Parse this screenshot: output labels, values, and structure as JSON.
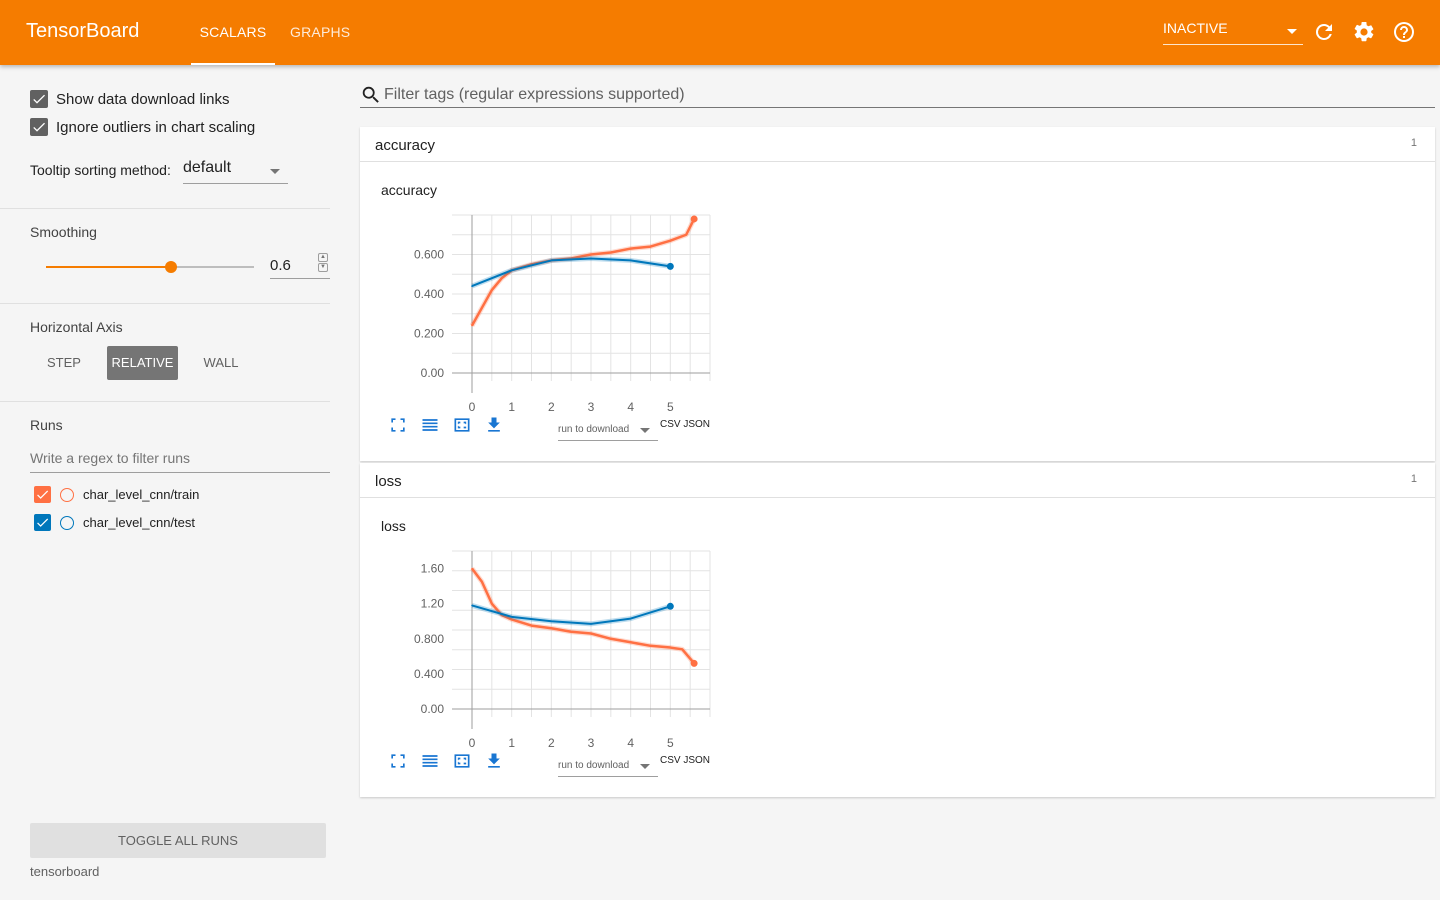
{
  "app": {
    "title": "TensorBoard",
    "tabs": [
      {
        "label": "SCALARS",
        "active": true
      },
      {
        "label": "GRAPHS",
        "active": false
      }
    ],
    "status_select": "INACTIVE",
    "icons": [
      "refresh-icon",
      "settings-icon",
      "help-icon"
    ],
    "accent_color": "#f57c00"
  },
  "sidebar": {
    "show_download_links": {
      "label": "Show data download links",
      "checked": true
    },
    "ignore_outliers": {
      "label": "Ignore outliers in chart scaling",
      "checked": true
    },
    "tooltip_sorting": {
      "label": "Tooltip sorting method:",
      "value": "default"
    },
    "smoothing": {
      "title": "Smoothing",
      "value": "0.6",
      "fraction": 0.6
    },
    "horizontal_axis": {
      "title": "Horizontal Axis",
      "options": [
        "STEP",
        "RELATIVE",
        "WALL"
      ],
      "selected": "RELATIVE"
    },
    "runs": {
      "title": "Runs",
      "filter_placeholder": "Write a regex to filter runs",
      "items": [
        {
          "name": "char_level_cnn/train",
          "color": "#ff7043",
          "checked": true
        },
        {
          "name": "char_level_cnn/test",
          "color": "#0077bb",
          "checked": true
        }
      ]
    },
    "toggle_all_label": "TOGGLE ALL RUNS",
    "footer": "tensorboard"
  },
  "main": {
    "search_placeholder": "Filter tags (regular expressions supported)",
    "panes": [
      {
        "title": "accuracy",
        "count": "1",
        "card_title": "accuracy"
      },
      {
        "title": "loss",
        "count": "1",
        "card_title": "loss"
      }
    ],
    "download": {
      "select_label": "run to download",
      "csv": "CSV",
      "json": "JSON"
    }
  },
  "chart_data": [
    {
      "type": "line",
      "title": "accuracy",
      "xlim": [
        0,
        6
      ],
      "ylim": [
        0,
        0.8
      ],
      "x_ticks": [
        "0",
        "1",
        "2",
        "3",
        "4",
        "5"
      ],
      "y_ticks": [
        "0.00",
        "0.200",
        "0.400",
        "0.600"
      ],
      "series": [
        {
          "name": "char_level_cnn/train",
          "color": "#ff7043",
          "x": [
            0,
            0.25,
            0.5,
            0.75,
            1,
            1.5,
            2,
            2.5,
            3,
            3.5,
            4,
            4.5,
            5,
            5.4,
            5.6
          ],
          "y": [
            0.24,
            0.33,
            0.42,
            0.48,
            0.52,
            0.55,
            0.57,
            0.58,
            0.6,
            0.61,
            0.63,
            0.64,
            0.67,
            0.7,
            0.78
          ]
        },
        {
          "name": "char_level_cnn/test",
          "color": "#0077bb",
          "x": [
            0,
            1,
            2,
            3,
            4,
            5
          ],
          "y": [
            0.44,
            0.52,
            0.57,
            0.58,
            0.57,
            0.54
          ]
        }
      ]
    },
    {
      "type": "line",
      "title": "loss",
      "xlim": [
        0,
        6
      ],
      "ylim": [
        0,
        1.8
      ],
      "x_ticks": [
        "0",
        "1",
        "2",
        "3",
        "4",
        "5"
      ],
      "y_ticks": [
        "0.00",
        "0.400",
        "0.800",
        "1.20",
        "1.60"
      ],
      "series": [
        {
          "name": "char_level_cnn/train",
          "color": "#ff7043",
          "x": [
            0,
            0.25,
            0.5,
            0.75,
            1,
            1.5,
            2,
            2.5,
            3,
            3.5,
            4,
            4.5,
            5,
            5.3,
            5.6
          ],
          "y": [
            1.6,
            1.45,
            1.2,
            1.07,
            1.02,
            0.95,
            0.92,
            0.88,
            0.86,
            0.8,
            0.76,
            0.72,
            0.7,
            0.68,
            0.52
          ]
        },
        {
          "name": "char_level_cnn/test",
          "color": "#0077bb",
          "x": [
            0,
            1,
            2,
            3,
            4,
            5
          ],
          "y": [
            1.18,
            1.05,
            1.0,
            0.97,
            1.03,
            1.17
          ]
        }
      ]
    }
  ]
}
